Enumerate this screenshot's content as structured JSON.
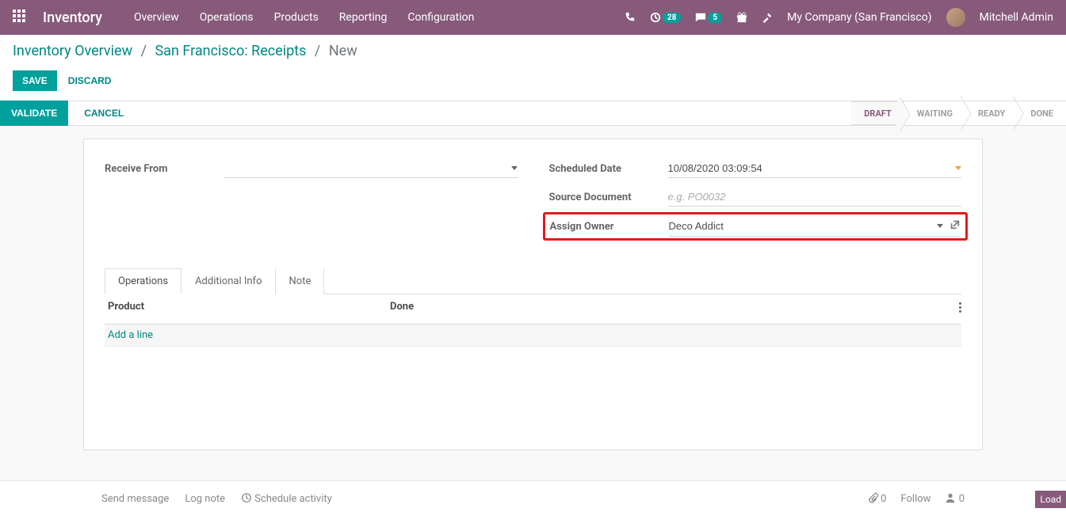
{
  "topnav": {
    "brand": "Inventory",
    "menu": [
      "Overview",
      "Operations",
      "Products",
      "Reporting",
      "Configuration"
    ],
    "clock_badge": "28",
    "chat_badge": "5",
    "company": "My Company (San Francisco)",
    "user": "Mitchell Admin"
  },
  "breadcrumb": {
    "items": [
      "Inventory Overview",
      "San Francisco: Receipts"
    ],
    "current": "New"
  },
  "buttons": {
    "save": "SAVE",
    "discard": "DISCARD",
    "validate": "VALIDATE",
    "cancel": "CANCEL"
  },
  "status_steps": [
    "DRAFT",
    "WAITING",
    "READY",
    "DONE"
  ],
  "status_active_index": 0,
  "form": {
    "receive_from_label": "Receive From",
    "receive_from_value": "",
    "scheduled_date_label": "Scheduled Date",
    "scheduled_date_value": "10/08/2020 03:09:54",
    "source_doc_label": "Source Document",
    "source_doc_placeholder": "e.g. PO0032",
    "source_doc_value": "",
    "assign_owner_label": "Assign Owner",
    "assign_owner_value": "Deco Addict"
  },
  "tabs": [
    "Operations",
    "Additional Info",
    "Note"
  ],
  "table": {
    "col_product": "Product",
    "col_done": "Done",
    "add_line": "Add a line"
  },
  "chatter": {
    "send_message": "Send message",
    "log_note": "Log note",
    "schedule_activity": "Schedule activity",
    "attachments": "0",
    "follow": "Follow",
    "followers": "0",
    "load": "Load"
  }
}
